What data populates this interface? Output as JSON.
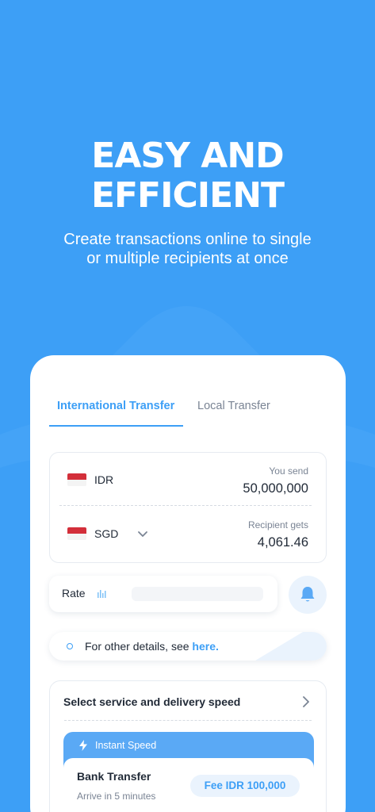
{
  "hero": {
    "title_line1": "EASY AND",
    "title_line2": "EFFICIENT",
    "subtitle_line1": "Create transactions online to single",
    "subtitle_line2": "or multiple recipients at once"
  },
  "tabs": {
    "international": "International Transfer",
    "local": "Local Transfer"
  },
  "exchange": {
    "send_currency": "IDR",
    "send_label": "You send",
    "send_amount": "50,000,000",
    "receive_currency": "SGD",
    "receive_label": "Recipient gets",
    "receive_amount": "4,061.46"
  },
  "rate": {
    "label": "Rate"
  },
  "info": {
    "text": "For other details, see ",
    "link": "here."
  },
  "service": {
    "title": "Select service and delivery speed",
    "speed_label": "Instant Speed",
    "bank_title": "Bank Transfer",
    "bank_sub": "Arrive in 5 minutes",
    "fee": "Fee IDR 100,000"
  },
  "colors": {
    "brand": "#3d9ff6",
    "text_dark": "#222b38",
    "text_muted": "#7a8494"
  },
  "icons": [
    "flag-indonesia-icon",
    "flag-singapore-icon",
    "chevron-down-icon",
    "bar-chart-icon",
    "bell-icon",
    "info-circle-icon",
    "chevron-right-icon",
    "lightning-icon"
  ]
}
